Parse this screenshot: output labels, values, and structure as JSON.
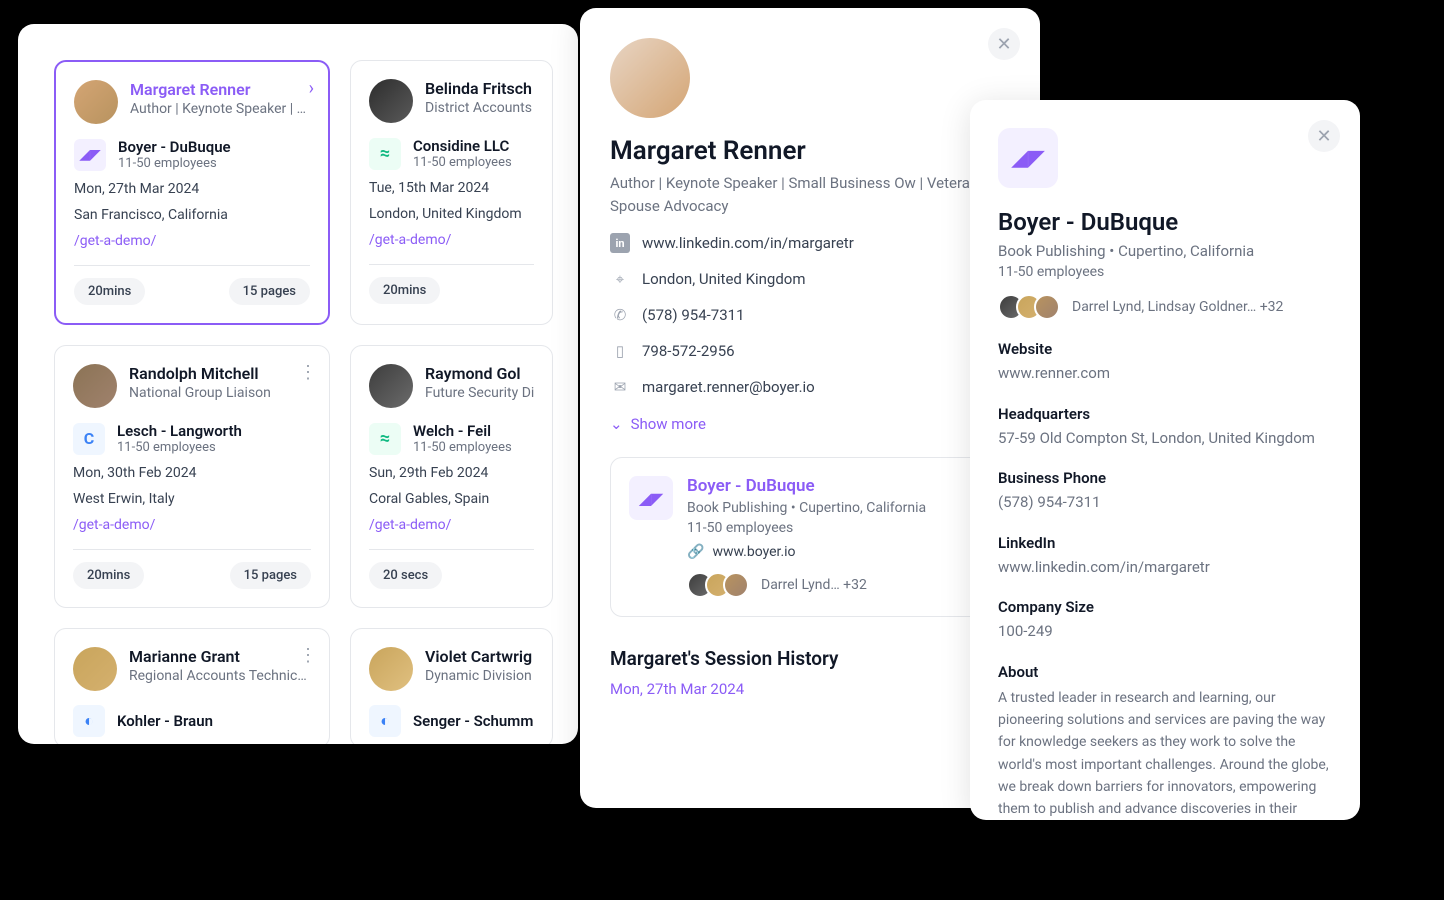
{
  "cards": [
    {
      "name": "Margaret Renner",
      "role": "Author | Keynote Speaker | Sm…",
      "company": "Boyer - DuBuque",
      "size": "11-50 employees",
      "date": "Mon, 27th Mar 2024",
      "location": "San Francisco, California",
      "link": "/get-a-demo/",
      "pill1": "20mins",
      "pill2": "15 pages",
      "selected": true
    },
    {
      "name": "Belinda Fritsch",
      "role": "District Accounts",
      "company": "Considine LLC",
      "size": "11-50 employees",
      "date": "Tue, 15th Mar 2024",
      "location": "London, United Kingdom",
      "link": "/get-a-demo/",
      "pill1": "20mins",
      "pill2": ""
    },
    {
      "name": "Randolph Mitchell",
      "role": "National Group Liaison",
      "company": "Lesch - Langworth",
      "size": "11-50 employees",
      "date": "Mon, 30th Feb 2024",
      "location": "West Erwin, Italy",
      "link": "/get-a-demo/",
      "pill1": "20mins",
      "pill2": "15 pages"
    },
    {
      "name": "Raymond Gol",
      "role": "Future Security Di",
      "company": "Welch - Feil",
      "size": "11-50 employees",
      "date": "Sun, 29th Feb 2024",
      "location": "Coral Gables, Spain",
      "link": "/get-a-demo/",
      "pill1": "20 secs",
      "pill2": ""
    },
    {
      "name": "Marianne Grant",
      "role": "Regional Accounts Technician",
      "company": "Kohler - Braun",
      "size": "",
      "date": "",
      "location": "",
      "link": "",
      "pill1": "",
      "pill2": ""
    },
    {
      "name": "Violet Cartwrig",
      "role": "Dynamic Division",
      "company": "Senger - Schumm",
      "size": "",
      "date": "",
      "location": "",
      "link": "",
      "pill1": "",
      "pill2": ""
    }
  ],
  "detail": {
    "name": "Margaret Renner",
    "role": "Author | Keynote Speaker | Small Business Ow | Veteran and Spouse Advocacy",
    "linkedin": "www.linkedin.com/in/margaretr",
    "location": "London, United Kingdom",
    "phone": "(578) 954-7311",
    "mobile": "798-572-2956",
    "email": "margaret.renner@boyer.io",
    "show_more": "Show more",
    "company": {
      "name": "Boyer - DuBuque",
      "sub": "Book Publishing • Cupertino, California",
      "size": "11-50 employees",
      "site": "www.boyer.io",
      "people": "Darrel Lynd… +32"
    },
    "history_title": "Margaret's Session History",
    "history_date": "Mon, 27th Mar 2024"
  },
  "company": {
    "name": "Boyer - DuBuque",
    "sub": "Book Publishing • Cupertino, California",
    "size": "11-50 employees",
    "people": "Darrel Lynd, Lindsay Goldner… +32",
    "website_label": "Website",
    "website": "www.renner.com",
    "hq_label": "Headquarters",
    "hq": "57-59 Old Compton St, London, United Kingdom",
    "phone_label": "Business Phone",
    "phone": "(578) 954-7311",
    "linkedin_label": "LinkedIn",
    "linkedin": "www.linkedin.com/in/margaretr",
    "size_label": "Company Size",
    "size_value": "100-249",
    "about_label": "About",
    "about": "A trusted leader in research and learning, our pioneering solutions and services are paving the way for knowledge seekers as they work to solve the world's most important challenges. Around the globe, we break down barriers for innovators, empowering them to publish and advance discoveries in their fields, evolve their"
  }
}
